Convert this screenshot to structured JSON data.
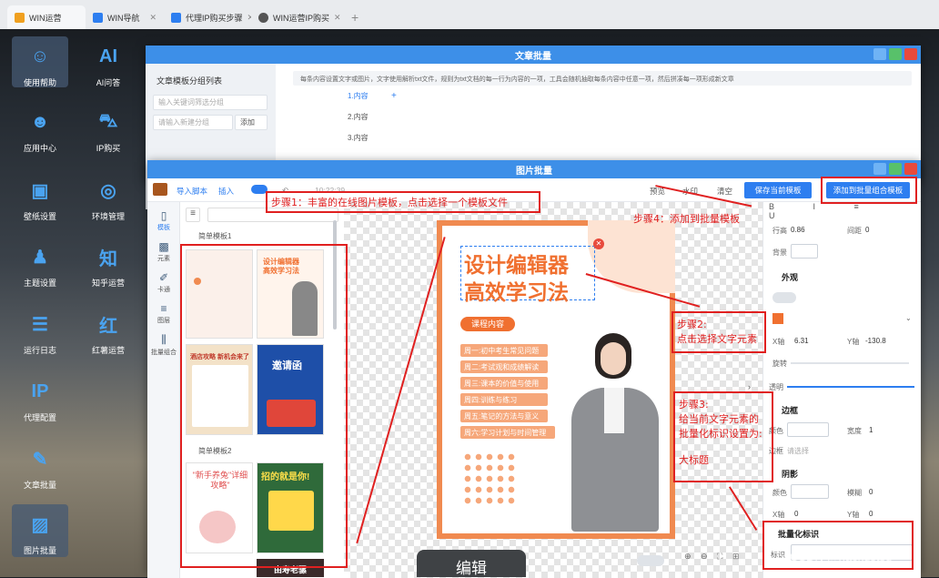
{
  "browser": {
    "tabs": [
      {
        "label": "WIN运营",
        "icon": "folder-icon",
        "color": "#f0a020"
      },
      {
        "label": "WIN导航",
        "icon": "nav-icon",
        "color": "#2d7ef0"
      },
      {
        "label": "代理IP购买步骤",
        "icon": "doc-icon",
        "color": "#2d7ef0"
      },
      {
        "label": "WIN运营IP购买",
        "icon": "globe-icon",
        "color": "#555"
      }
    ]
  },
  "dock": [
    {
      "label": "使用帮助",
      "glyph": "☺"
    },
    {
      "label": "AI问答",
      "glyph": "AI"
    },
    {
      "label": "应用中心",
      "glyph": "☻"
    },
    {
      "label": "IP购买",
      "glyph": "⛍"
    },
    {
      "label": "壁纸设置",
      "glyph": "▣"
    },
    {
      "label": "环境管理",
      "glyph": "◎"
    },
    {
      "label": "主题设置",
      "glyph": "♟"
    },
    {
      "label": "知乎运营",
      "glyph": "知"
    },
    {
      "label": "运行日志",
      "glyph": "☰"
    },
    {
      "label": "红薯运营",
      "glyph": "红"
    },
    {
      "label": "代理配置",
      "glyph": "IP"
    },
    {
      "label": "文章批量",
      "glyph": "✎"
    },
    {
      "label": "图片批量",
      "glyph": "▨"
    }
  ],
  "article_window": {
    "title": "文章批量",
    "side_title": "文章模板分组列表",
    "search_placeholder": "输入关键词筛选分组",
    "new_group_placeholder": "请输入新建分组",
    "add_label": "添加",
    "hint": "每条内容设置文字或图片，文字使用解析txt文件，规则为txt文档的每一行为内容的一项，工具会随机抽取每条内容中任意一项，然后拼凑每一项形成新文章",
    "items": [
      "1.内容",
      "2.内容",
      "3.内容"
    ],
    "plus": "+"
  },
  "image_window": {
    "title": "图片批量",
    "toolbar": {
      "import": "导入脚本",
      "insert": "插入",
      "time": "10:22:39",
      "preview": "预览",
      "watermark": "水印",
      "clear": "清空",
      "save_template": "保存当前模板",
      "add_to_batch": "添加到批量组合模板"
    },
    "icon_tabs": [
      {
        "label": "模板",
        "glyph": "▯"
      },
      {
        "label": "元素",
        "glyph": "▩"
      },
      {
        "label": "卡通",
        "glyph": "✐"
      },
      {
        "label": "图层",
        "glyph": "≡"
      },
      {
        "label": "批量组合",
        "glyph": "⫼"
      }
    ],
    "groups": [
      "简单模板1",
      "简单模板2"
    ],
    "thumbs": [
      {
        "text": "",
        "bg": "#fbf0ea"
      },
      {
        "text": "设计编辑器 高效学习法",
        "bg": "#fff4ec"
      },
      {
        "text": "酒店攻略 新机会来了",
        "bg": "#f3e2c8"
      },
      {
        "text": "邀请函",
        "bg": "#1e4fa8"
      },
      {
        "text": "\"新手养兔\"详细攻略\"",
        "bg": "#fff"
      },
      {
        "text": "招的就是你!",
        "bg": "#2f6a3a"
      }
    ],
    "thumb_bottom": "由寿老骡",
    "poster": {
      "title1": "设计编辑器",
      "title2": "高效学习法",
      "badge": "课程内容",
      "rows": [
        "周一:初中考生常见问题",
        "周二:考试观和成绩解读",
        "周三:课本的价值与使用",
        "周四:训练与练习",
        "周五:笔记的方法与意义",
        "周六:学习计划与时间管理"
      ]
    },
    "props": {
      "line_height_label": "行高",
      "line_height": "0.86",
      "spacing_label": "间距",
      "spacing": "0",
      "bg_label": "背景",
      "appearance": "外观",
      "opacity_label": "透明",
      "x_label": "X轴",
      "x_val": "6.31",
      "y_label": "Y轴",
      "y_val": "-130.8",
      "rotate_label": "旋转",
      "border": "边框",
      "color_label": "颜色",
      "width_label": "宽度",
      "width_val": "1",
      "side_label": "边框",
      "side_val": "请选择",
      "shadow": "阴影",
      "blur_label": "模糊",
      "blur_val": "0",
      "shadow_x": "0",
      "shadow_y": "0",
      "batch_label": "批量化标识",
      "mark_label": "标识",
      "accent": "#f07030"
    },
    "bottom_button": "编辑"
  },
  "annotations": {
    "step1": "步骤1：丰富的在线图片模板，点击选择一个模板文件",
    "step2": "步骤2:\n点击选择文字元素",
    "step3": "步骤3:\n给当前文字元素的\n批量化标识设置为:\n\n大标题",
    "step4": "步骤4：添加到批量模板"
  },
  "watermark": "CSDN @hackdstsd"
}
